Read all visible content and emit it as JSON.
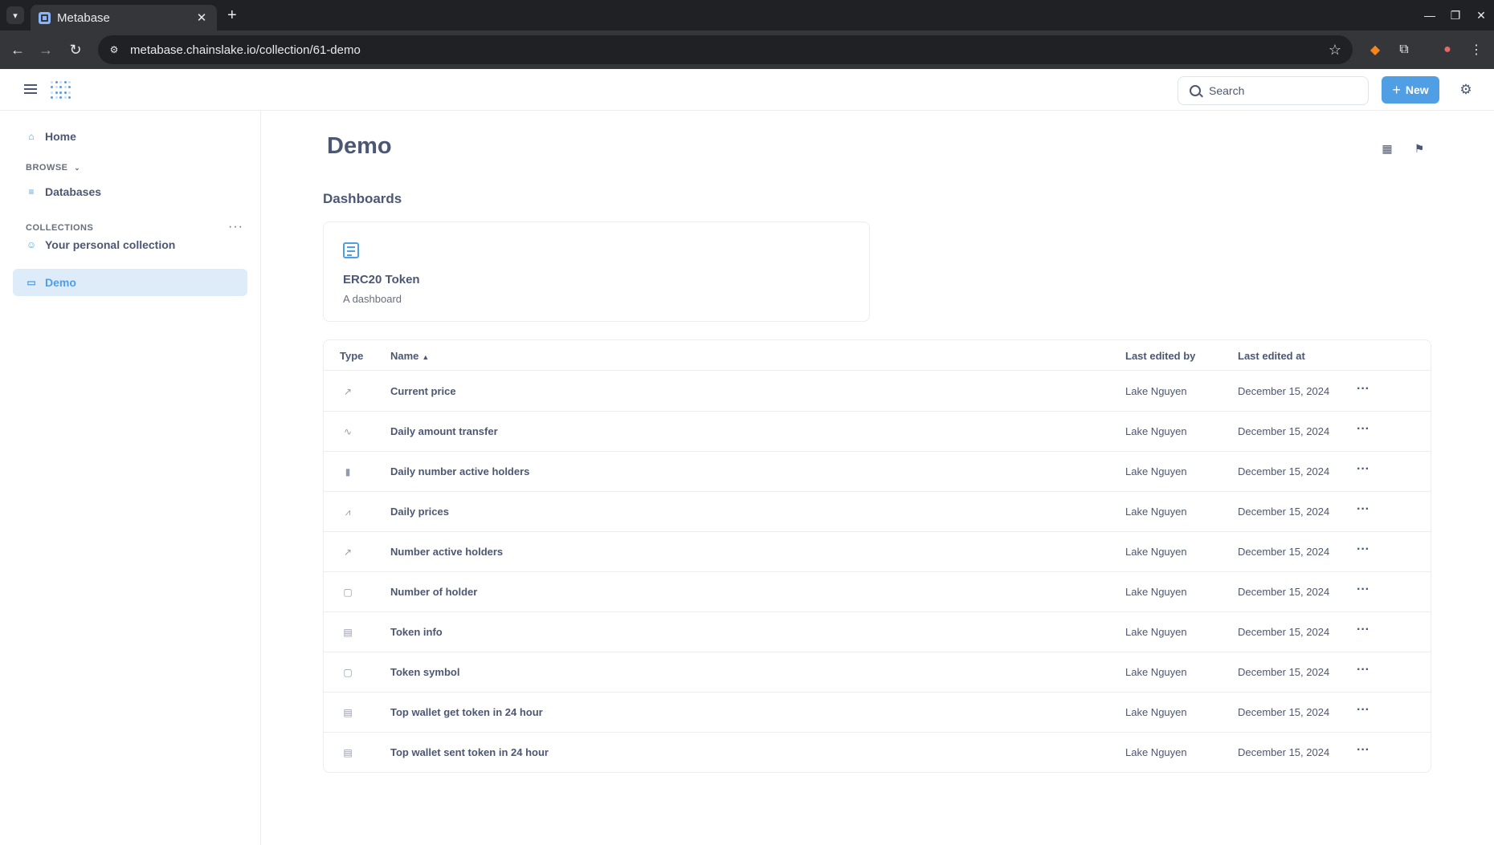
{
  "browser": {
    "tab_title": "Metabase",
    "url": "metabase.chainslake.io/collection/61-demo"
  },
  "header": {
    "search_placeholder": "Search",
    "new_label": "New"
  },
  "sidebar": {
    "home_label": "Home",
    "browse_heading": "BROWSE",
    "databases_label": "Databases",
    "collections_heading": "COLLECTIONS",
    "items": [
      {
        "label": "Your personal collection",
        "icon": "person-icon"
      },
      {
        "label": "Demo",
        "icon": "folder-icon",
        "active": true
      }
    ]
  },
  "main": {
    "title": "Demo",
    "dashboards_heading": "Dashboards",
    "dashboard_card": {
      "name": "ERC20 Token",
      "description": "A dashboard"
    },
    "table": {
      "columns": [
        "Type",
        "Name",
        "Last edited by",
        "Last edited at"
      ],
      "rows": [
        {
          "icon": "trend-icon",
          "name": "Current price",
          "editor": "Lake Nguyen",
          "date": "December 15, 2024"
        },
        {
          "icon": "line-icon",
          "name": "Daily amount transfer",
          "editor": "Lake Nguyen",
          "date": "December 15, 2024"
        },
        {
          "icon": "bar-icon",
          "name": "Daily number active holders",
          "editor": "Lake Nguyen",
          "date": "December 15, 2024"
        },
        {
          "icon": "combo-icon",
          "name": "Daily prices",
          "editor": "Lake Nguyen",
          "date": "December 15, 2024"
        },
        {
          "icon": "trend-icon",
          "name": "Number active holders",
          "editor": "Lake Nguyen",
          "date": "December 15, 2024"
        },
        {
          "icon": "number-icon",
          "name": "Number of holder",
          "editor": "Lake Nguyen",
          "date": "December 15, 2024"
        },
        {
          "icon": "table-icon",
          "name": "Token info",
          "editor": "Lake Nguyen",
          "date": "December 15, 2024"
        },
        {
          "icon": "number-icon",
          "name": "Token symbol",
          "editor": "Lake Nguyen",
          "date": "December 15, 2024"
        },
        {
          "icon": "table-icon",
          "name": "Top wallet get token in 24 hour",
          "editor": "Lake Nguyen",
          "date": "December 15, 2024"
        },
        {
          "icon": "table-icon",
          "name": "Top wallet sent token in 24 hour",
          "editor": "Lake Nguyen",
          "date": "December 15, 2024"
        }
      ]
    }
  },
  "colors": {
    "brand": "#509ee3",
    "text": "#4c5773",
    "active_bg": "#deebf8"
  }
}
